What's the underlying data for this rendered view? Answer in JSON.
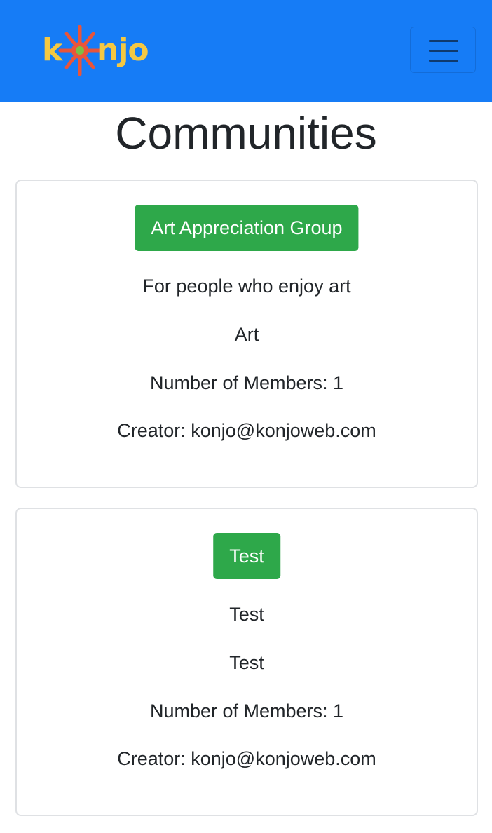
{
  "navbar": {
    "brand": "konjo",
    "brand_parts": {
      "first": "k",
      "rest": "njo"
    },
    "background_color": "#167cf6",
    "toggler_icon": "hamburger-menu-icon"
  },
  "page": {
    "title": "Communities"
  },
  "communities": [
    {
      "name": "Art Appreciation Group",
      "description": "For people who enjoy art",
      "category": "Art",
      "members_label": "Number of Members: 1",
      "creator_label": "Creator: konjo@konjoweb.com"
    },
    {
      "name": "Test",
      "description": "Test",
      "category": "Test",
      "members_label": "Number of Members: 1",
      "creator_label": "Creator: konjo@konjoweb.com"
    }
  ],
  "colors": {
    "button": "#2ea84a",
    "logo_yellow": "#f5c842",
    "logo_sun": "#e8553a",
    "logo_center": "#7bc043"
  }
}
